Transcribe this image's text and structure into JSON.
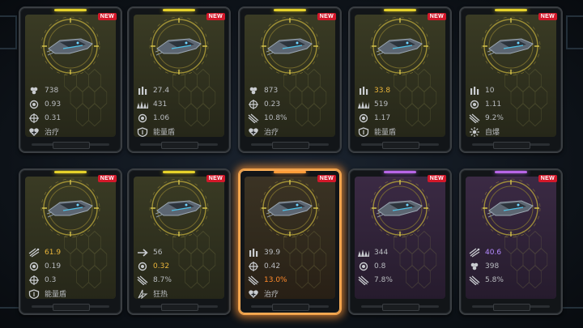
{
  "colors": {
    "gold": "#e9b53a",
    "violet": "#b48aff",
    "orange": "#ff8a2a",
    "new_badge": "#d3182a",
    "selected": "#f0a14a"
  },
  "cards": [
    {
      "new": "NEW",
      "rarity": "gold",
      "stats": [
        {
          "icon": "cluster-icon",
          "value": "738"
        },
        {
          "icon": "ring-icon",
          "value": "0.93"
        },
        {
          "icon": "crosshair-icon",
          "value": "0.31"
        },
        {
          "icon": "heal-icon",
          "value": "治疗"
        }
      ]
    },
    {
      "new": "NEW",
      "rarity": "gold",
      "stats": [
        {
          "icon": "ammo-icon",
          "value": "27.4"
        },
        {
          "icon": "spikes-icon",
          "value": "431"
        },
        {
          "icon": "ring-icon",
          "value": "1.06"
        },
        {
          "icon": "shield-icon",
          "value": "能量盾"
        }
      ]
    },
    {
      "new": "NEW",
      "rarity": "gold",
      "stats": [
        {
          "icon": "cluster-icon",
          "value": "873"
        },
        {
          "icon": "crosshair-icon",
          "value": "0.23"
        },
        {
          "icon": "missiles-icon",
          "value": "10.8%"
        },
        {
          "icon": "heal-icon",
          "value": "治疗"
        }
      ]
    },
    {
      "new": "NEW",
      "rarity": "gold",
      "stats": [
        {
          "icon": "ammo-icon",
          "value": "33.8",
          "color": "gold"
        },
        {
          "icon": "spikes-icon",
          "value": "519"
        },
        {
          "icon": "ring-icon",
          "value": "1.17"
        },
        {
          "icon": "shield-icon",
          "value": "能量盾"
        }
      ]
    },
    {
      "new": "NEW",
      "rarity": "gold",
      "stats": [
        {
          "icon": "ammo-icon",
          "value": "10"
        },
        {
          "icon": "ring-icon",
          "value": "1.11"
        },
        {
          "icon": "missiles-icon",
          "value": "9.2%"
        },
        {
          "icon": "explosion-icon",
          "value": "自爆"
        }
      ]
    },
    {
      "new": "NEW",
      "rarity": "gold",
      "stats": [
        {
          "icon": "burst-icon",
          "value": "61.9",
          "color": "gold"
        },
        {
          "icon": "ring-icon",
          "value": "0.19"
        },
        {
          "icon": "crosshair-icon",
          "value": "0.3"
        },
        {
          "icon": "shield-icon",
          "value": "能量盾"
        }
      ]
    },
    {
      "new": "NEW",
      "rarity": "gold",
      "stats": [
        {
          "icon": "arrow-icon",
          "value": "56"
        },
        {
          "icon": "ring-icon",
          "value": "0.32",
          "color": "gold"
        },
        {
          "icon": "missiles-icon",
          "value": "8.7%"
        },
        {
          "icon": "frenzy-icon",
          "value": "狂热"
        }
      ]
    },
    {
      "new": "NEW",
      "rarity": "orange",
      "selected": true,
      "stats": [
        {
          "icon": "ammo-icon",
          "value": "39.9"
        },
        {
          "icon": "crosshair-icon",
          "value": "0.42"
        },
        {
          "icon": "missiles-icon",
          "value": "13.0%",
          "color": "orange"
        },
        {
          "icon": "heal-icon",
          "value": "治疗"
        }
      ]
    },
    {
      "new": "NEW",
      "rarity": "purple",
      "stats": [
        {
          "icon": "spikes-icon",
          "value": "344"
        },
        {
          "icon": "ring-icon",
          "value": "0.8"
        },
        {
          "icon": "missiles-icon",
          "value": "7.8%"
        }
      ]
    },
    {
      "new": "NEW",
      "rarity": "purple",
      "stats": [
        {
          "icon": "burst-icon",
          "value": "40.6",
          "color": "violet"
        },
        {
          "icon": "cluster-icon",
          "value": "398"
        },
        {
          "icon": "missiles-icon",
          "value": "5.8%"
        }
      ]
    }
  ]
}
